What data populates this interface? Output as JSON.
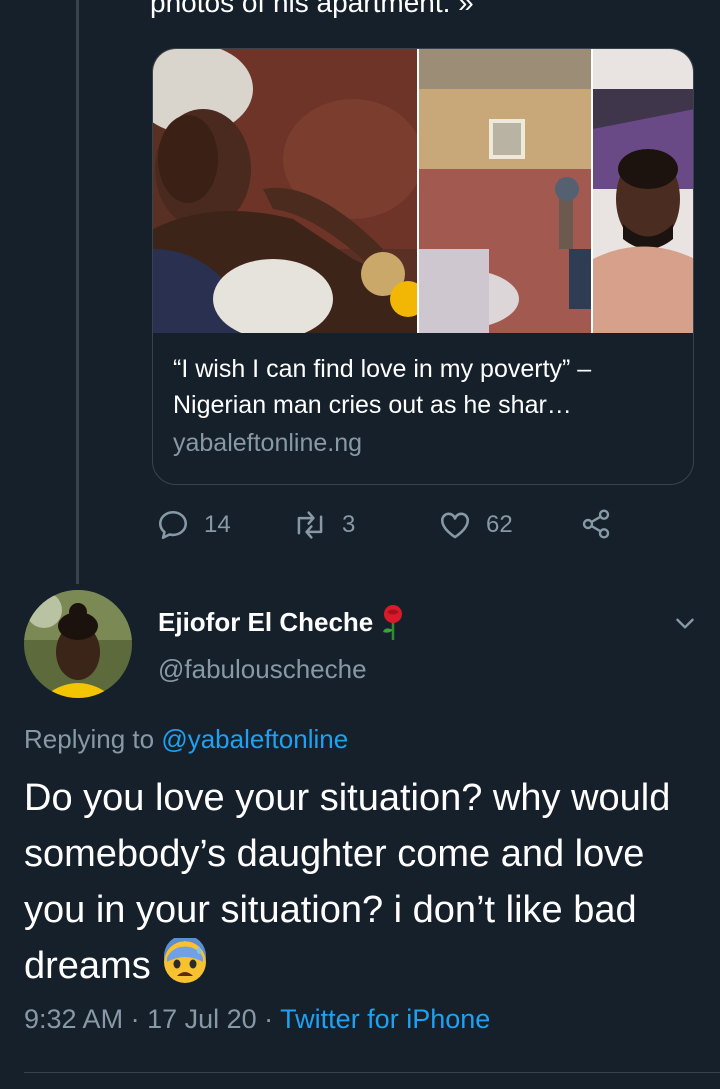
{
  "previous_tweet": {
    "truncated_text": "photos of his apartment. »",
    "card": {
      "title": "“I wish I can find love in my poverty” – Nigerian man cries out as he shar…",
      "domain": "yabaleftonline.ng"
    },
    "actions": {
      "reply_count": "14",
      "retweet_count": "3",
      "like_count": "62"
    }
  },
  "reply_tweet": {
    "display_name": "Ejiofor El Cheche",
    "name_emoji": "rose-emoji",
    "handle": "@fabulouscheche",
    "replying_prefix": "Replying to",
    "replying_to": "@yabaleftonline",
    "text": "Do you love your situation? why would somebody’s daughter come and love you in your situation? i don’t like bad dreams",
    "text_emoji": "anxious-face-with-sweat-emoji",
    "time": "9:32 AM",
    "date": "17 Jul 20",
    "separator": " · ",
    "source": "Twitter for iPhone"
  },
  "colors": {
    "background": "#15202b",
    "secondary_text": "#8899a6",
    "accent": "#1da1f2",
    "border": "#38444d"
  }
}
